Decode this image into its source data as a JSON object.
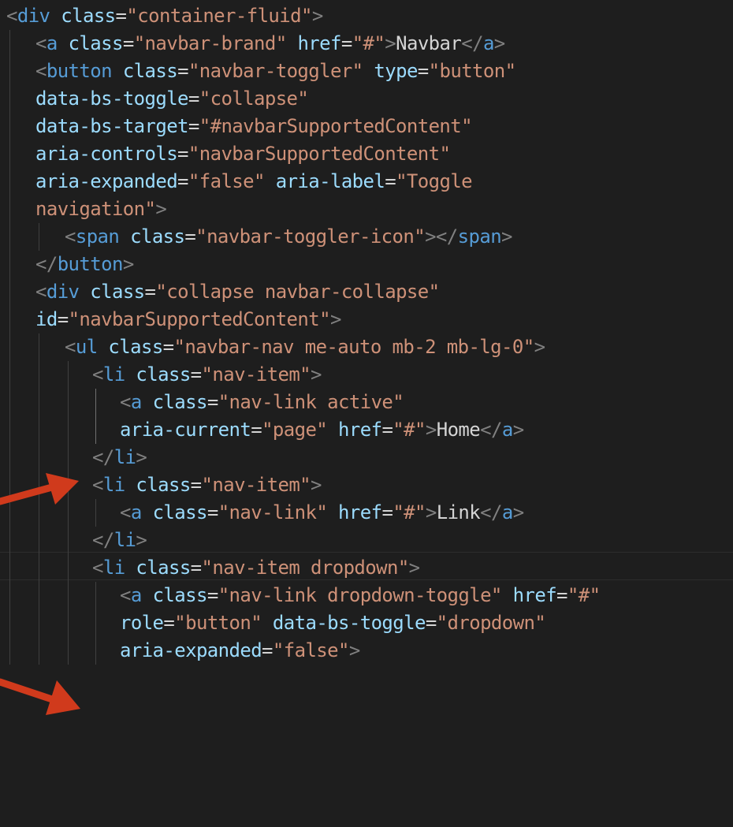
{
  "theme": {
    "background": "#1e1e1e",
    "tag_color": "#569cd6",
    "attr_color": "#9cdcfe",
    "string_color": "#ce9178",
    "punct_color": "#808080",
    "text_color": "#d4d4d4",
    "arrow_color": "#d03a1c"
  },
  "icons": [
    "arrow-pointer-icon"
  ],
  "lines": [
    [
      {
        "t": "punct",
        "v": "<"
      },
      {
        "t": "tag",
        "v": "div"
      },
      {
        "t": "text",
        "v": " "
      },
      {
        "t": "attr",
        "v": "class"
      },
      {
        "t": "eq",
        "v": "="
      },
      {
        "t": "str",
        "v": "\"container-fluid\""
      },
      {
        "t": "punct",
        "v": ">"
      }
    ],
    [
      {
        "t": "punct",
        "v": "<"
      },
      {
        "t": "tag",
        "v": "a"
      },
      {
        "t": "text",
        "v": " "
      },
      {
        "t": "attr",
        "v": "class"
      },
      {
        "t": "eq",
        "v": "="
      },
      {
        "t": "str",
        "v": "\"navbar-brand\""
      },
      {
        "t": "text",
        "v": " "
      },
      {
        "t": "attr",
        "v": "href"
      },
      {
        "t": "eq",
        "v": "="
      },
      {
        "t": "str",
        "v": "\"#\""
      },
      {
        "t": "punct",
        "v": ">"
      },
      {
        "t": "text",
        "v": "Navbar"
      },
      {
        "t": "punct",
        "v": "</"
      },
      {
        "t": "tag",
        "v": "a"
      },
      {
        "t": "punct",
        "v": ">"
      }
    ],
    [
      {
        "t": "punct",
        "v": "<"
      },
      {
        "t": "tag",
        "v": "button"
      },
      {
        "t": "text",
        "v": " "
      },
      {
        "t": "attr",
        "v": "class"
      },
      {
        "t": "eq",
        "v": "="
      },
      {
        "t": "str",
        "v": "\"navbar-toggler\""
      },
      {
        "t": "text",
        "v": " "
      },
      {
        "t": "attr",
        "v": "type"
      },
      {
        "t": "eq",
        "v": "="
      },
      {
        "t": "str",
        "v": "\"button\""
      }
    ],
    [
      {
        "t": "attr",
        "v": "data-bs-toggle"
      },
      {
        "t": "eq",
        "v": "="
      },
      {
        "t": "str",
        "v": "\"collapse\""
      }
    ],
    [
      {
        "t": "attr",
        "v": "data-bs-target"
      },
      {
        "t": "eq",
        "v": "="
      },
      {
        "t": "str",
        "v": "\"#navbarSupportedContent\""
      }
    ],
    [
      {
        "t": "attr",
        "v": "aria-controls"
      },
      {
        "t": "eq",
        "v": "="
      },
      {
        "t": "str",
        "v": "\"navbarSupportedContent\""
      }
    ],
    [
      {
        "t": "attr",
        "v": "aria-expanded"
      },
      {
        "t": "eq",
        "v": "="
      },
      {
        "t": "str",
        "v": "\"false\""
      },
      {
        "t": "text",
        "v": " "
      },
      {
        "t": "attr",
        "v": "aria-label"
      },
      {
        "t": "eq",
        "v": "="
      },
      {
        "t": "str",
        "v": "\"Toggle"
      }
    ],
    [
      {
        "t": "str",
        "v": "navigation\""
      },
      {
        "t": "punct",
        "v": ">"
      }
    ],
    [
      {
        "t": "punct",
        "v": "<"
      },
      {
        "t": "tag",
        "v": "span"
      },
      {
        "t": "text",
        "v": " "
      },
      {
        "t": "attr",
        "v": "class"
      },
      {
        "t": "eq",
        "v": "="
      },
      {
        "t": "str",
        "v": "\"navbar-toggler-icon\""
      },
      {
        "t": "punct",
        "v": "></"
      },
      {
        "t": "tag",
        "v": "span"
      },
      {
        "t": "punct",
        "v": ">"
      }
    ],
    [
      {
        "t": "punct",
        "v": "</"
      },
      {
        "t": "tag",
        "v": "button"
      },
      {
        "t": "punct",
        "v": ">"
      }
    ],
    [
      {
        "t": "punct",
        "v": "<"
      },
      {
        "t": "tag",
        "v": "div"
      },
      {
        "t": "text",
        "v": " "
      },
      {
        "t": "attr",
        "v": "class"
      },
      {
        "t": "eq",
        "v": "="
      },
      {
        "t": "str",
        "v": "\"collapse navbar-collapse\""
      }
    ],
    [
      {
        "t": "attr",
        "v": "id"
      },
      {
        "t": "eq",
        "v": "="
      },
      {
        "t": "str",
        "v": "\"navbarSupportedContent\""
      },
      {
        "t": "punct",
        "v": ">"
      }
    ],
    [
      {
        "t": "punct",
        "v": "<"
      },
      {
        "t": "tag",
        "v": "ul"
      },
      {
        "t": "text",
        "v": " "
      },
      {
        "t": "attr",
        "v": "class"
      },
      {
        "t": "eq",
        "v": "="
      },
      {
        "t": "str",
        "v": "\"navbar-nav me-auto mb-2 mb-lg-0\""
      },
      {
        "t": "punct",
        "v": ">"
      }
    ],
    [
      {
        "t": "punct",
        "v": "<"
      },
      {
        "t": "tag",
        "v": "li"
      },
      {
        "t": "text",
        "v": " "
      },
      {
        "t": "attr",
        "v": "class"
      },
      {
        "t": "eq",
        "v": "="
      },
      {
        "t": "str",
        "v": "\"nav-item\""
      },
      {
        "t": "punct",
        "v": ">"
      }
    ],
    [
      {
        "t": "punct",
        "v": "<"
      },
      {
        "t": "tag",
        "v": "a"
      },
      {
        "t": "text",
        "v": " "
      },
      {
        "t": "attr",
        "v": "class"
      },
      {
        "t": "eq",
        "v": "="
      },
      {
        "t": "str",
        "v": "\"nav-link active\""
      }
    ],
    [
      {
        "t": "attr",
        "v": "aria-current"
      },
      {
        "t": "eq",
        "v": "="
      },
      {
        "t": "str",
        "v": "\"page\""
      },
      {
        "t": "text",
        "v": " "
      },
      {
        "t": "attr",
        "v": "href"
      },
      {
        "t": "eq",
        "v": "="
      },
      {
        "t": "str",
        "v": "\"#\""
      },
      {
        "t": "punct",
        "v": ">"
      },
      {
        "t": "text",
        "v": "Home"
      },
      {
        "t": "punct",
        "v": "</"
      },
      {
        "t": "tag",
        "v": "a"
      },
      {
        "t": "punct",
        "v": ">"
      }
    ],
    [
      {
        "t": "punct",
        "v": "</"
      },
      {
        "t": "tag",
        "v": "li"
      },
      {
        "t": "punct",
        "v": ">"
      }
    ],
    [
      {
        "t": "punct",
        "v": "<"
      },
      {
        "t": "tag",
        "v": "li"
      },
      {
        "t": "text",
        "v": " "
      },
      {
        "t": "attr",
        "v": "class"
      },
      {
        "t": "eq",
        "v": "="
      },
      {
        "t": "str",
        "v": "\"nav-item\""
      },
      {
        "t": "punct",
        "v": ">"
      }
    ],
    [
      {
        "t": "punct",
        "v": "<"
      },
      {
        "t": "tag",
        "v": "a"
      },
      {
        "t": "text",
        "v": " "
      },
      {
        "t": "attr",
        "v": "class"
      },
      {
        "t": "eq",
        "v": "="
      },
      {
        "t": "str",
        "v": "\"nav-link\""
      },
      {
        "t": "text",
        "v": " "
      },
      {
        "t": "attr",
        "v": "href"
      },
      {
        "t": "eq",
        "v": "="
      },
      {
        "t": "str",
        "v": "\"#\""
      },
      {
        "t": "punct",
        "v": ">"
      },
      {
        "t": "text",
        "v": "Link"
      },
      {
        "t": "punct",
        "v": "</"
      },
      {
        "t": "tag",
        "v": "a"
      },
      {
        "t": "punct",
        "v": ">"
      }
    ],
    [
      {
        "t": "punct",
        "v": "</"
      },
      {
        "t": "tag",
        "v": "li"
      },
      {
        "t": "punct",
        "v": ">"
      }
    ],
    [
      {
        "t": "punct",
        "v": "<"
      },
      {
        "t": "tag",
        "v": "li"
      },
      {
        "t": "text",
        "v": " "
      },
      {
        "t": "attr",
        "v": "class"
      },
      {
        "t": "eq",
        "v": "="
      },
      {
        "t": "str",
        "v": "\"nav-item dropdown\""
      },
      {
        "t": "punct",
        "v": ">"
      }
    ],
    [
      {
        "t": "punct",
        "v": "<"
      },
      {
        "t": "tag",
        "v": "a"
      },
      {
        "t": "text",
        "v": " "
      },
      {
        "t": "attr",
        "v": "class"
      },
      {
        "t": "eq",
        "v": "="
      },
      {
        "t": "str",
        "v": "\"nav-link dropdown-toggle\""
      },
      {
        "t": "text",
        "v": " "
      },
      {
        "t": "attr",
        "v": "href"
      },
      {
        "t": "eq",
        "v": "="
      },
      {
        "t": "str",
        "v": "\"#\""
      }
    ],
    [
      {
        "t": "attr",
        "v": "role"
      },
      {
        "t": "eq",
        "v": "="
      },
      {
        "t": "str",
        "v": "\"button\""
      },
      {
        "t": "text",
        "v": " "
      },
      {
        "t": "attr",
        "v": "data-bs-toggle"
      },
      {
        "t": "eq",
        "v": "="
      },
      {
        "t": "str",
        "v": "\"dropdown\""
      }
    ],
    [
      {
        "t": "attr",
        "v": "aria-expanded"
      },
      {
        "t": "eq",
        "v": "="
      },
      {
        "t": "str",
        "v": "\"false\""
      },
      {
        "t": "punct",
        "v": ">"
      }
    ]
  ]
}
